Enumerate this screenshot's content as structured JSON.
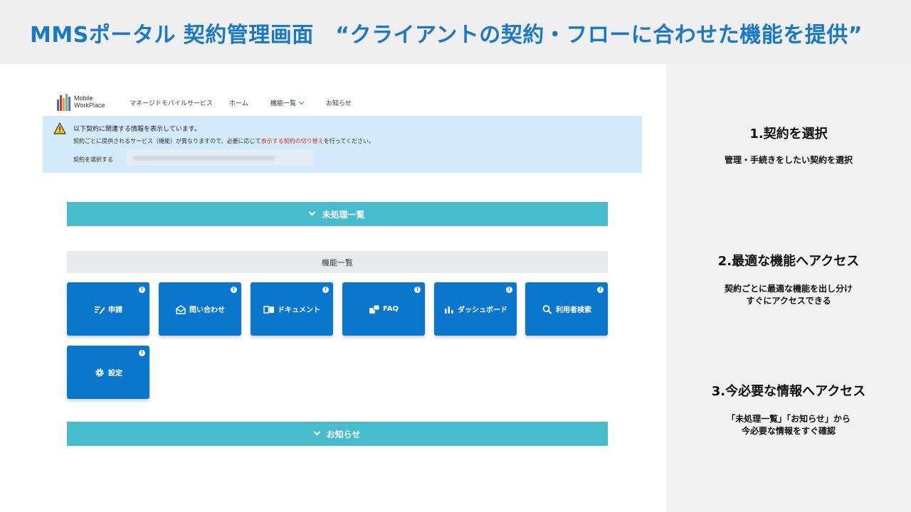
{
  "slide": {
    "title": "MMSポータル 契約管理画面　“クライアントの契約・フローに合わせた機能を提供”"
  },
  "colors": {
    "title_blue": "#1a78c8",
    "tile_blue": "#0a77cc",
    "accordion_teal": "#47bccd",
    "banner_blue": "#d3eafb",
    "highlight_red": "#e0302a"
  },
  "portal": {
    "logo": {
      "line1": "Mobile",
      "line2": "WorkPlace"
    },
    "nav": {
      "managed_mobile": "マネージドモバイルサービス",
      "home": "ホーム",
      "features": "機能一覧",
      "news": "お知らせ"
    },
    "banner": {
      "title": "以下契約に関連する情報を表示しています。",
      "body_before": "契約ごとに提供されるサービス（機能）が異なりますので、必要に応じて",
      "body_highlight": "表示する契約の切り替え",
      "body_after": "を行ってください。",
      "select_label": "契約を選択する"
    },
    "pending_label": "未処理一覧",
    "features_header": "機能一覧",
    "tiles": [
      {
        "label": "申請",
        "icon": "application-icon"
      },
      {
        "label": "問い合わせ",
        "icon": "inquiry-icon"
      },
      {
        "label": "ドキュメント",
        "icon": "document-icon"
      },
      {
        "label": "FAQ",
        "icon": "faq-icon"
      },
      {
        "label": "ダッシュボード",
        "icon": "dashboard-icon"
      },
      {
        "label": "利用者検索",
        "icon": "search-icon"
      },
      {
        "label": "設定",
        "icon": "gear-icon"
      }
    ],
    "news_label": "お知らせ"
  },
  "steps": [
    {
      "title": "1.契約を選択",
      "desc_line1": "管理・手続きをしたい契約を選択",
      "desc_line2": ""
    },
    {
      "title": "2.最適な機能へアクセス",
      "desc_line1": "契約ごとに最適な機能を出し分け",
      "desc_line2": "すぐにアクセスできる"
    },
    {
      "title": "3.今必要な情報へアクセス",
      "desc_line1": "「未処理一覧」「お知らせ」から",
      "desc_line2": "今必要な情報をすぐ確認"
    }
  ]
}
